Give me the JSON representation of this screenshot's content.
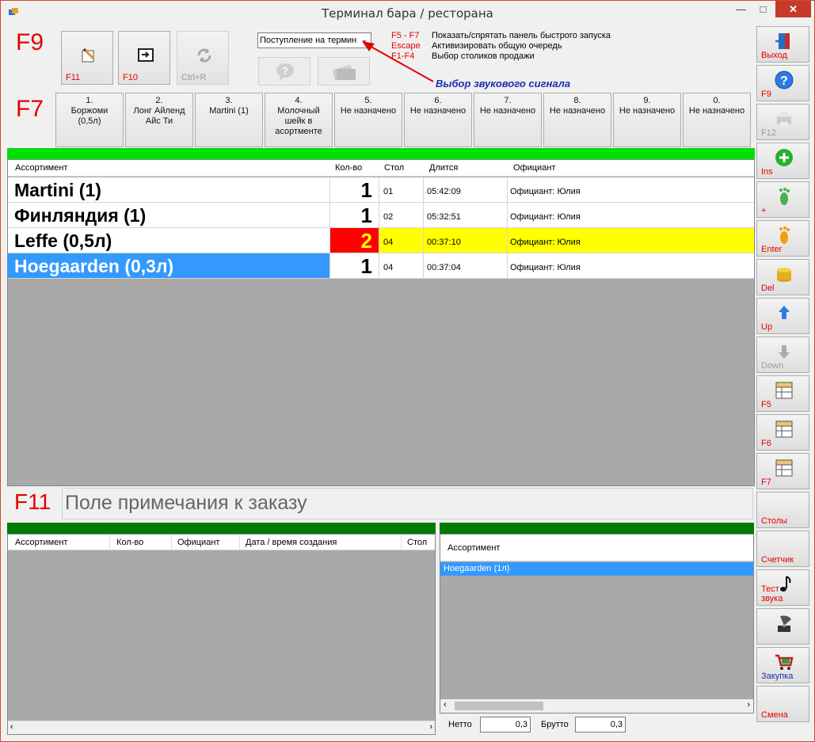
{
  "window": {
    "title": "Терминал бара / ресторана"
  },
  "toolbar": {
    "f9_label": "F9",
    "f7_label": "F7",
    "btn_edit_key": "F11",
    "btn_enter_key": "F10",
    "btn_refresh_key": "Ctrl+R",
    "sound_select_value": "Поступление на термин",
    "hints": [
      {
        "key": "F5 - F7",
        "desc": "Показать/спрятать панель быстрого запуска"
      },
      {
        "key": "Escape",
        "desc": "Активизировать общую очередь"
      },
      {
        "key": "F1-F4",
        "desc": "Выбор столиков продажи"
      }
    ],
    "annotation": "Выбор звукового сигнала"
  },
  "quick": [
    {
      "label": "1.\nБоржоми\n(0,5л)"
    },
    {
      "label": "2.\nЛонг Айленд\nАйс Ти"
    },
    {
      "label": "3.\nMartini (1)"
    },
    {
      "label": "4.\nМолочный\nшейк в\nасортменте"
    },
    {
      "label": "5.\nНе назначено"
    },
    {
      "label": "6.\nНе назначено"
    },
    {
      "label": "7.\nНе назначено"
    },
    {
      "label": "8.\nНе назначено"
    },
    {
      "label": "9.\nНе назначено"
    },
    {
      "label": "0.\nНе назначено"
    }
  ],
  "orders": {
    "columns": {
      "name": "Ассортимент",
      "qty": "Кол-во",
      "table": "Стол",
      "duration": "Длится",
      "waiter": "Официант"
    },
    "rows": [
      {
        "name": "Martini (1)",
        "qty": "1",
        "table": "01",
        "duration": "05:42:09",
        "waiter": "Официант: Юлия",
        "state": "normal"
      },
      {
        "name": "Финляндия (1)",
        "qty": "1",
        "table": "02",
        "duration": "05:32:51",
        "waiter": "Официант: Юлия",
        "state": "normal"
      },
      {
        "name": "Leffe (0,5л)",
        "qty": "2",
        "table": "04",
        "duration": "00:37:10",
        "waiter": "Официант: Юлия",
        "state": "highlight"
      },
      {
        "name": "Hoegaarden (0,3л)",
        "qty": "1",
        "table": "04",
        "duration": "00:37:04",
        "waiter": "Официант: Юлия",
        "state": "selected"
      }
    ]
  },
  "note": {
    "key": "F11",
    "placeholder": "Поле примечания к заказу"
  },
  "history": {
    "columns": {
      "name": "Ассортимент",
      "qty": "Кол-во",
      "waiter": "Официант",
      "created": "Дата / время создания",
      "table": "Стол"
    }
  },
  "stock": {
    "column": "Ассортимент",
    "items": [
      "Hoegaarden (1л)"
    ],
    "netto_label": "Нетто",
    "netto_value": "0,3",
    "brutto_label": "Брутто",
    "brutto_value": "0,3"
  },
  "sidebar": [
    {
      "label": "Выход",
      "icon": "exit-door-icon",
      "disabled": false
    },
    {
      "label": "F9",
      "icon": "help-icon",
      "disabled": false
    },
    {
      "label": "F12",
      "icon": "printer-icon",
      "disabled": true
    },
    {
      "label": "Ins",
      "icon": "add-icon",
      "disabled": false
    },
    {
      "label": "+",
      "icon": "footprint-green-icon",
      "disabled": false
    },
    {
      "label": "Enter",
      "icon": "footprint-orange-icon",
      "disabled": false
    },
    {
      "label": "Del",
      "icon": "coins-icon",
      "disabled": false
    },
    {
      "label": "Up",
      "icon": "arrow-up-icon",
      "disabled": false
    },
    {
      "label": "Down",
      "icon": "arrow-down-icon",
      "disabled": true
    },
    {
      "label": "F5",
      "icon": "table-icon",
      "disabled": false
    },
    {
      "label": "F6",
      "icon": "table-icon",
      "disabled": false
    },
    {
      "label": "F7",
      "icon": "table-icon",
      "disabled": false
    },
    {
      "label": "Столы",
      "icon": "",
      "disabled": false
    },
    {
      "label": "Счетчик",
      "icon": "",
      "disabled": false
    },
    {
      "label": "Тест\nзвука",
      "icon": "music-note-icon",
      "disabled": false
    },
    {
      "label": "",
      "icon": "gramophone-icon",
      "disabled": false
    },
    {
      "label": "Закупка",
      "icon": "shopping-cart-icon",
      "disabled": false
    },
    {
      "label": "Смена",
      "icon": "",
      "disabled": false
    }
  ],
  "colors": {
    "accent_red": "#e60000",
    "bar_green": "#00e000",
    "panel_green": "#007a00",
    "highlight_yellow": "#ffff00",
    "qty_alert": "#ff0000",
    "selection_blue": "#3399ff"
  }
}
